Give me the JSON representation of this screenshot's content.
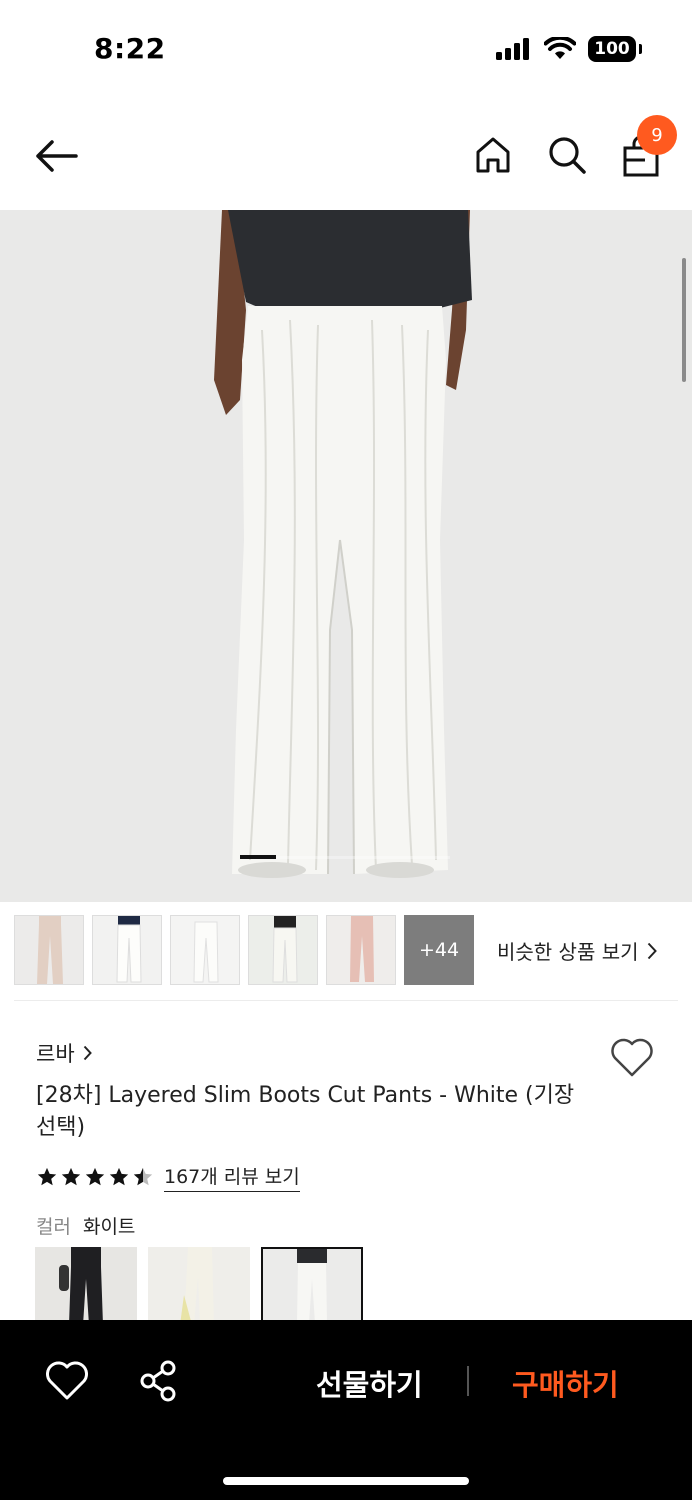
{
  "status_bar": {
    "time": "8:22",
    "battery": "100",
    "icons": [
      "signal-icon",
      "wifi-icon",
      "battery-icon"
    ]
  },
  "header": {
    "icons": [
      "back-arrow-icon",
      "home-icon",
      "search-icon",
      "shopping-bag-icon"
    ],
    "cart_count": "9"
  },
  "gallery": {
    "image": "product-photo-white-wide-leg-pants",
    "thumbnails": [
      "beige-pants",
      "white-pants-navy-top",
      "white-pants",
      "white-pants-black-top",
      "pink-pants"
    ],
    "more_label": "+44",
    "similar_label": "비슷한 상품 보기"
  },
  "product": {
    "brand": "르바",
    "title": "[28차] Layered Slim Boots Cut Pants - White (기장 선택)",
    "rating": 4.5,
    "review_label": "167개 리뷰 보기",
    "color_label": "컬러",
    "color_value": "화이트",
    "swatches": [
      "black",
      "ivory",
      "white"
    ],
    "selected_swatch": "white"
  },
  "bottom_bar": {
    "gift_label": "선물하기",
    "buy_label": "구매하기"
  },
  "colors": {
    "accent": "#ff5a1f",
    "bar": "#000000"
  }
}
